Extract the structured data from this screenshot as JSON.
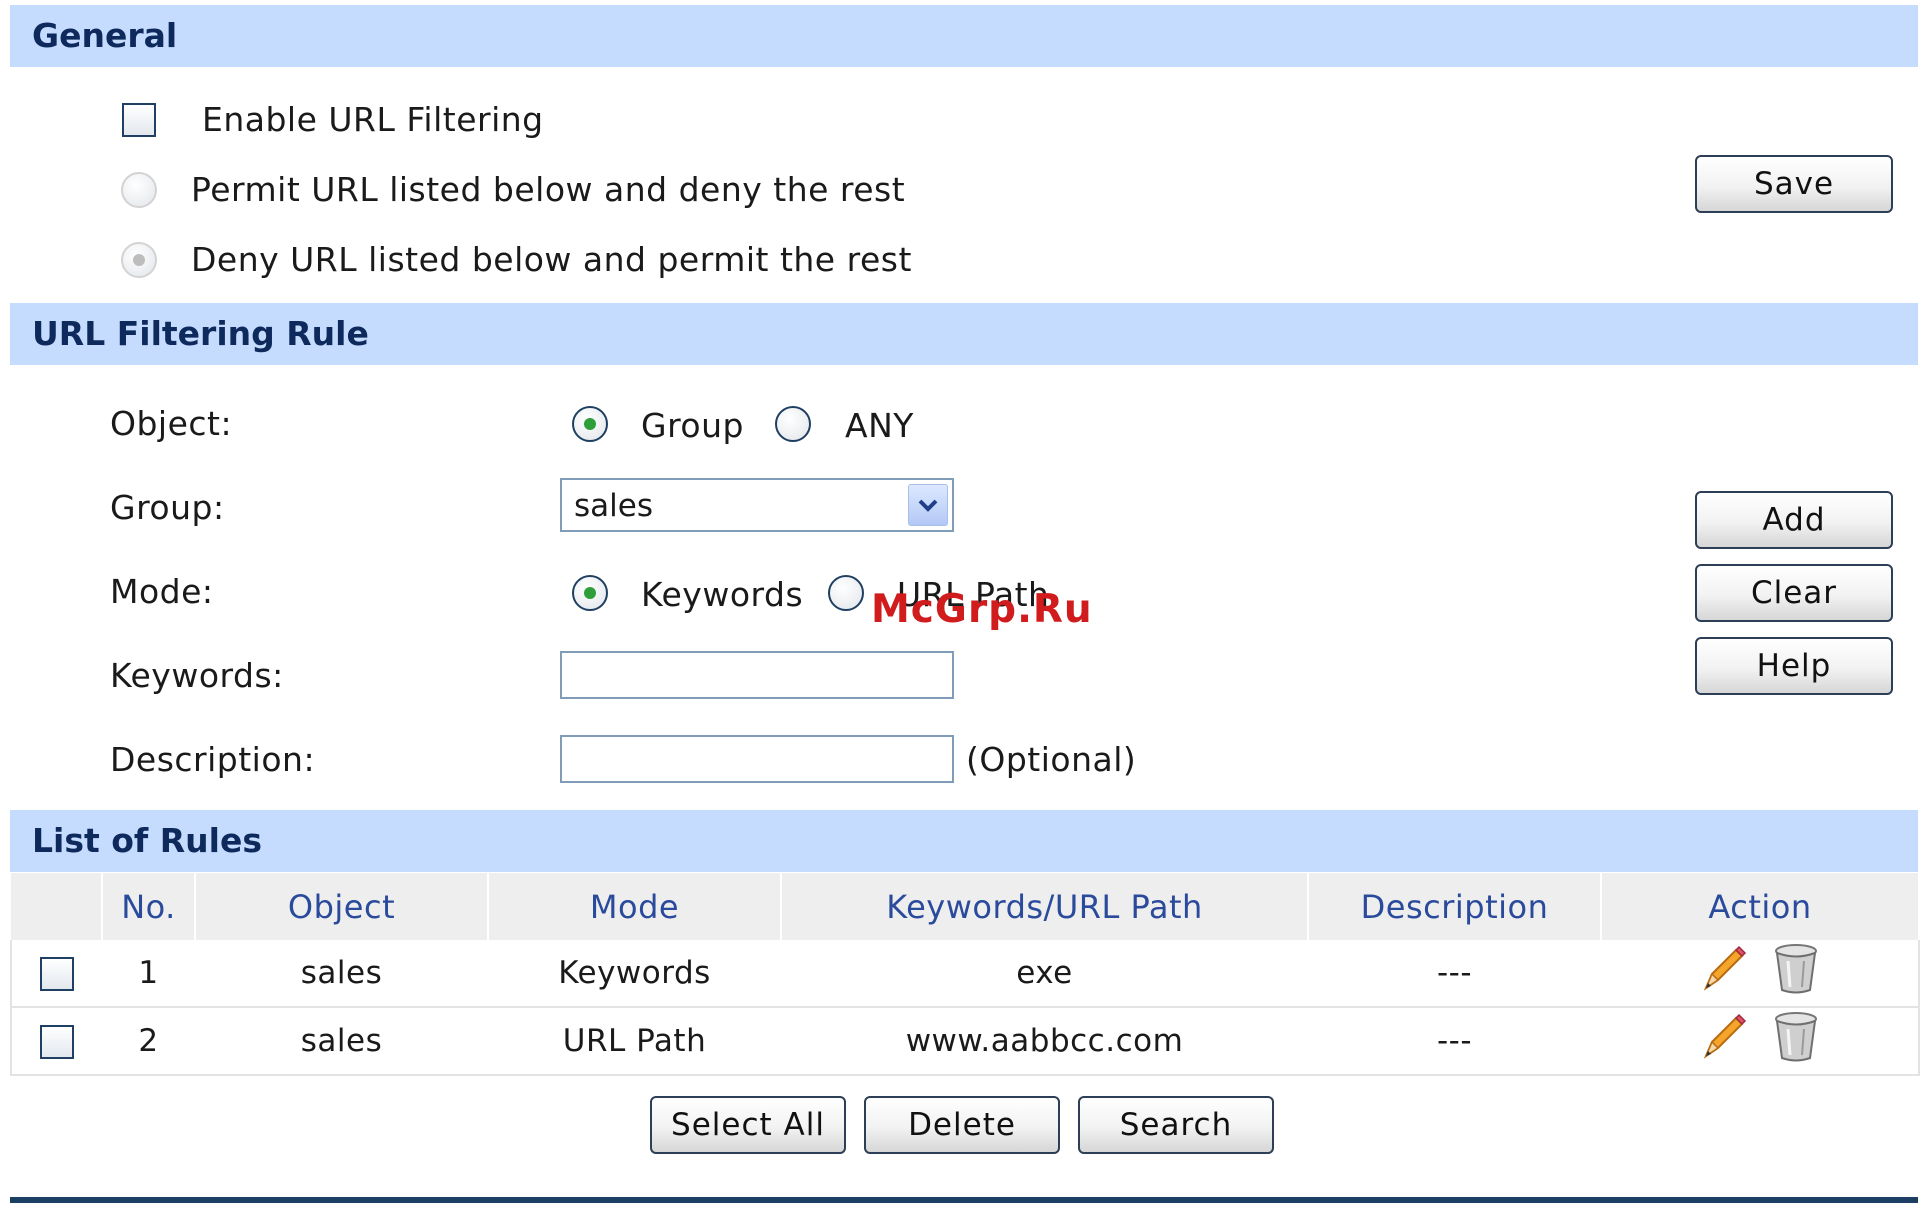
{
  "general": {
    "title": "General",
    "enable_label": "Enable URL Filtering",
    "enable_checked": false,
    "permit_label": "Permit URL listed below and deny the rest",
    "deny_label": "Deny URL listed below and permit the rest",
    "selected_policy": "deny",
    "save_label": "Save"
  },
  "rule_form": {
    "title": "URL Filtering Rule",
    "object_label": "Object:",
    "object_options": [
      "Group",
      "ANY"
    ],
    "object_selected": "Group",
    "group_label": "Group:",
    "group_value": "sales",
    "mode_label": "Mode:",
    "mode_options": [
      "Keywords",
      "URL Path"
    ],
    "mode_selected": "Keywords",
    "keywords_label": "Keywords:",
    "keywords_value": "",
    "description_label": "Description:",
    "description_value": "",
    "optional_hint": "(Optional)",
    "add_label": "Add",
    "clear_label": "Clear",
    "help_label": "Help"
  },
  "rules_list": {
    "title": "List of Rules",
    "columns": [
      "No.",
      "Object",
      "Mode",
      "Keywords/URL Path",
      "Description",
      "Action"
    ],
    "rows": [
      {
        "no": "1",
        "object": "sales",
        "mode": "Keywords",
        "path": "exe",
        "description": "---"
      },
      {
        "no": "2",
        "object": "sales",
        "mode": "URL Path",
        "path": "www.aabbcc.com",
        "description": "---"
      }
    ],
    "select_all_label": "Select All",
    "delete_label": "Delete",
    "search_label": "Search"
  },
  "icons": {
    "edit": "pencil-icon",
    "delete": "trash-icon"
  },
  "watermark": "McGrp.Ru",
  "colors": {
    "section_bar": "#c6dcff",
    "section_title": "#0e2a5c",
    "table_header_text": "#2a4a9c",
    "footer_line": "#1c3d64"
  }
}
